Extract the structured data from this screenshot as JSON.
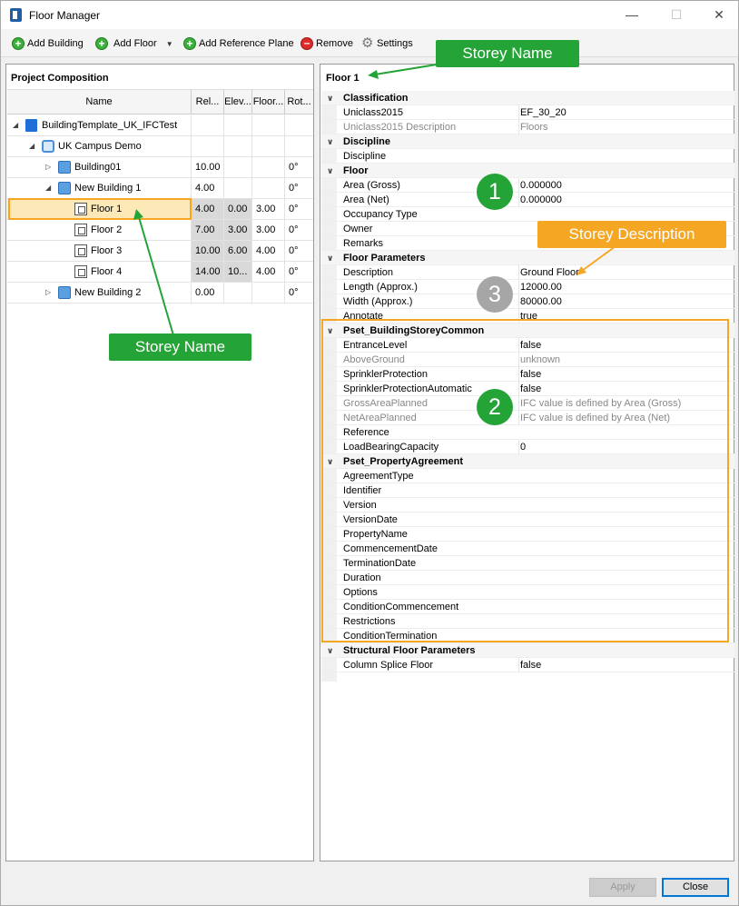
{
  "window": {
    "title": "Floor Manager",
    "min_icon": "minimize-icon",
    "max_icon": "maximize-icon",
    "close_icon": "close-icon",
    "min": "—",
    "max": "☐",
    "close": "✕"
  },
  "toolbar": {
    "add_building": "Add Building",
    "add_floor": "Add Floor",
    "add_reference_plane": "Add Reference Plane",
    "remove": "Remove",
    "settings": "Settings",
    "plus": "+",
    "minus": "–",
    "gear": "⚙",
    "dropdown": "▼"
  },
  "left": {
    "title": "Project Composition",
    "columns": [
      "Name",
      "Rel...",
      "Elev...",
      "Floor...",
      "Rot..."
    ],
    "rows": [
      {
        "label": "BuildingTemplate_UK_IFCTest",
        "icon": "project-icon",
        "expander": "◢",
        "rel": "",
        "elev": "",
        "floor": "",
        "rot": ""
      },
      {
        "label": "UK Campus Demo",
        "icon": "site-icon",
        "expander": "◢",
        "rel": "",
        "elev": "",
        "floor": "",
        "rot": ""
      },
      {
        "label": "Building01",
        "icon": "building-icon",
        "expander": "▷",
        "rel": "10.00",
        "elev": "",
        "floor": "",
        "rot": "0°"
      },
      {
        "label": "New Building 1",
        "icon": "building-icon",
        "expander": "◢",
        "rel": "4.00",
        "elev": "",
        "floor": "",
        "rot": "0°"
      },
      {
        "label": "Floor 1",
        "icon": "floor-icon",
        "expander": "",
        "rel": "4.00",
        "elev": "0.00",
        "floor": "3.00",
        "rot": "0°"
      },
      {
        "label": "Floor 2",
        "icon": "floor-icon",
        "expander": "",
        "rel": "7.00",
        "elev": "3.00",
        "floor": "3.00",
        "rot": "0°"
      },
      {
        "label": "Floor 3",
        "icon": "floor-icon",
        "expander": "",
        "rel": "10.00",
        "elev": "6.00",
        "floor": "4.00",
        "rot": "0°"
      },
      {
        "label": "Floor 4",
        "icon": "floor-icon",
        "expander": "",
        "rel": "14.00",
        "elev": "10...",
        "floor": "4.00",
        "rot": "0°"
      },
      {
        "label": "New Building 2",
        "icon": "building-icon",
        "expander": "▷",
        "rel": "0.00",
        "elev": "",
        "floor": "",
        "rot": "0°"
      }
    ]
  },
  "right": {
    "title": "Floor 1",
    "chevron": "∨",
    "props": [
      {
        "type": "cat",
        "label": "Classification"
      },
      {
        "type": "prop",
        "name": "Uniclass2015",
        "value": "EF_30_20",
        "gray": false
      },
      {
        "type": "prop",
        "name": "Uniclass2015 Description",
        "value": "Floors",
        "gray": true
      },
      {
        "type": "cat",
        "label": "Discipline"
      },
      {
        "type": "prop",
        "name": "Discipline",
        "value": "",
        "gray": false
      },
      {
        "type": "cat",
        "label": "Floor"
      },
      {
        "type": "prop",
        "name": "Area (Gross)",
        "value": "0.000000",
        "gray": false
      },
      {
        "type": "prop",
        "name": "Area (Net)",
        "value": "0.000000",
        "gray": false
      },
      {
        "type": "prop",
        "name": "Occupancy Type",
        "value": "",
        "gray": false
      },
      {
        "type": "prop",
        "name": "Owner",
        "value": "",
        "gray": false
      },
      {
        "type": "prop",
        "name": "Remarks",
        "value": "",
        "gray": false
      },
      {
        "type": "cat",
        "label": "Floor Parameters"
      },
      {
        "type": "prop",
        "name": "Description",
        "value": "Ground Floor",
        "gray": false
      },
      {
        "type": "prop",
        "name": "Length (Approx.)",
        "value": "12000.00",
        "gray": false
      },
      {
        "type": "prop",
        "name": "Width (Approx.)",
        "value": "80000.00",
        "gray": false
      },
      {
        "type": "prop",
        "name": "Annotate",
        "value": "true",
        "gray": false
      },
      {
        "type": "cat",
        "label": "Pset_BuildingStoreyCommon"
      },
      {
        "type": "prop",
        "name": "EntranceLevel",
        "value": "false",
        "gray": false
      },
      {
        "type": "prop",
        "name": "AboveGround",
        "value": "unknown",
        "gray": true
      },
      {
        "type": "prop",
        "name": "SprinklerProtection",
        "value": "false",
        "gray": false
      },
      {
        "type": "prop",
        "name": "SprinklerProtectionAutomatic",
        "value": "false",
        "gray": false
      },
      {
        "type": "prop",
        "name": "GrossAreaPlanned",
        "value": "IFC value is defined by Area (Gross)",
        "gray": true
      },
      {
        "type": "prop",
        "name": "NetAreaPlanned",
        "value": "IFC value is defined by Area (Net)",
        "gray": true
      },
      {
        "type": "prop",
        "name": "Reference",
        "value": "",
        "gray": false
      },
      {
        "type": "prop",
        "name": "LoadBearingCapacity",
        "value": "0",
        "gray": false
      },
      {
        "type": "cat",
        "label": "Pset_PropertyAgreement"
      },
      {
        "type": "prop",
        "name": "AgreementType",
        "value": "",
        "gray": false
      },
      {
        "type": "prop",
        "name": "Identifier",
        "value": "",
        "gray": false
      },
      {
        "type": "prop",
        "name": "Version",
        "value": "",
        "gray": false
      },
      {
        "type": "prop",
        "name": "VersionDate",
        "value": "",
        "gray": false
      },
      {
        "type": "prop",
        "name": "PropertyName",
        "value": "",
        "gray": false
      },
      {
        "type": "prop",
        "name": "CommencementDate",
        "value": "",
        "gray": false
      },
      {
        "type": "prop",
        "name": "TerminationDate",
        "value": "",
        "gray": false
      },
      {
        "type": "prop",
        "name": "Duration",
        "value": "",
        "gray": false
      },
      {
        "type": "prop",
        "name": "Options",
        "value": "",
        "gray": false
      },
      {
        "type": "prop",
        "name": "ConditionCommencement",
        "value": "",
        "gray": false
      },
      {
        "type": "prop",
        "name": "Restrictions",
        "value": "",
        "gray": false
      },
      {
        "type": "prop",
        "name": "ConditionTermination",
        "value": "",
        "gray": false
      },
      {
        "type": "cat",
        "label": "Structural Floor Parameters"
      },
      {
        "type": "prop",
        "name": "Column Splice Floor",
        "value": "false",
        "gray": false
      }
    ]
  },
  "annotations": {
    "storey_name_top": "Storey Name",
    "storey_name_left": "Storey Name",
    "storey_description": "Storey Description",
    "badge_1": "1",
    "badge_2": "2",
    "badge_3": "3",
    "green": "#24a336",
    "orange": "#f5a623",
    "gray_badge": "#a6a6a6"
  },
  "buttons": {
    "apply": "Apply",
    "close": "Close"
  }
}
